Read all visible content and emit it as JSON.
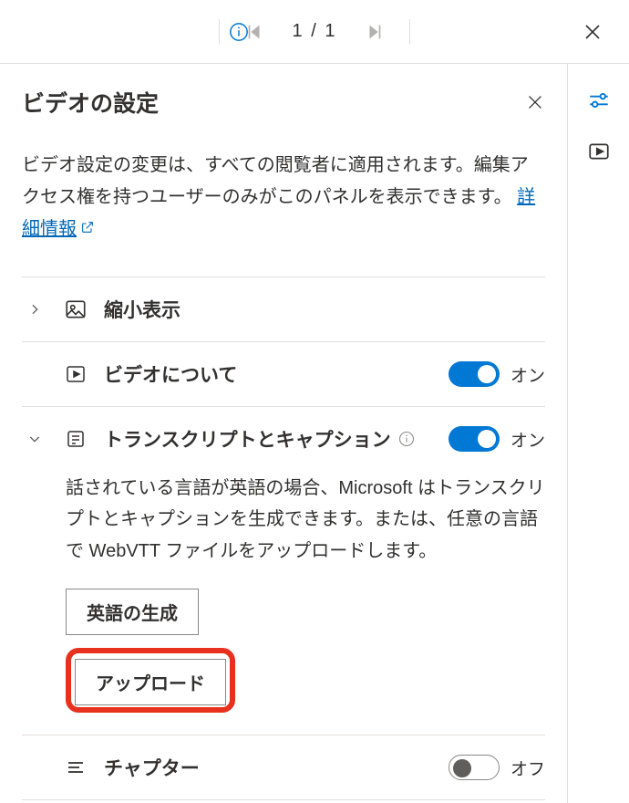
{
  "topbar": {
    "page_counter": "1 / 1"
  },
  "panel": {
    "title": "ビデオの設定",
    "description_part1": "ビデオ設定の変更は、すべての閲覧者に適用されます。編集アクセス権を持つユーザーのみがこのパネルを表示できます。 ",
    "more_info_link": "詳細情報"
  },
  "sections": {
    "thumbnail": {
      "title": "縮小表示"
    },
    "about": {
      "title": "ビデオについて",
      "toggle_label": "オン"
    },
    "transcript": {
      "title": "トランスクリプトとキャプション",
      "toggle_label": "オン",
      "body": "話されている言語が英語の場合、Microsoft はトランスクリプトとキャプションを生成できます。または、任意の言語で WebVTT ファイルをアップロードします。",
      "generate_btn": "英語の生成",
      "upload_btn": "アップロード"
    },
    "chapters": {
      "title": "チャプター",
      "toggle_label": "オフ"
    }
  }
}
